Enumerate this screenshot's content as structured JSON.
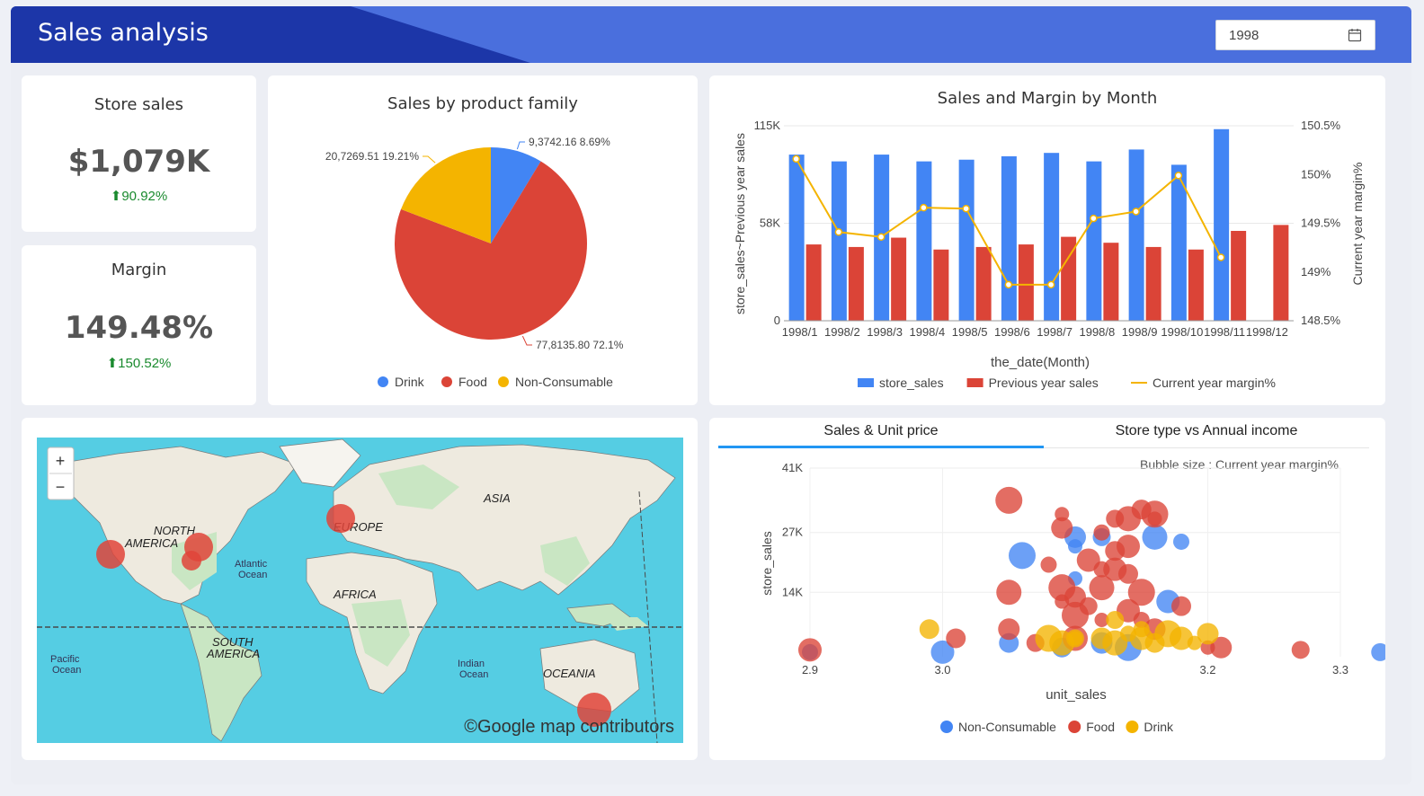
{
  "header": {
    "title": "Sales analysis",
    "year": "1998"
  },
  "kpis": {
    "store_sales": {
      "title": "Store sales",
      "value": "$1,079K",
      "delta": "90.92%"
    },
    "margin": {
      "title": "Margin",
      "value": "149.48%",
      "delta": "150.52%"
    }
  },
  "pie": {
    "title": "Sales by product family",
    "chart_data": {
      "type": "pie",
      "categories": [
        "Drink",
        "Food",
        "Non-Consumable"
      ],
      "values": [
        93742.16,
        778135.8,
        207269.51
      ],
      "percents": [
        8.69,
        72.1,
        19.21
      ],
      "labels": [
        "9,3742.16 8.69%",
        "77,8135.80 72.1%",
        "20,7269.51 19.21%"
      ],
      "colors": [
        "#4285f4",
        "#db4437",
        "#f4b400"
      ],
      "legend": "bottom"
    }
  },
  "month_chart": {
    "title": "Sales and Margin by Month",
    "chart_data": {
      "type": "bar",
      "categories": [
        "1998/1",
        "1998/2",
        "1998/3",
        "1998/4",
        "1998/5",
        "1998/6",
        "1998/7",
        "1998/8",
        "1998/9",
        "1998/10",
        "1998/11",
        "1998/12"
      ],
      "series": [
        {
          "name": "store_sales",
          "type": "bar",
          "color": "#4285f4",
          "values": [
            98000,
            94000,
            98000,
            94000,
            95000,
            97000,
            99000,
            94000,
            101000,
            92000,
            113000,
            null
          ]
        },
        {
          "name": "Previous year sales",
          "type": "bar",
          "color": "#db4437",
          "values": [
            45000,
            43500,
            49000,
            42000,
            43500,
            45000,
            49500,
            46000,
            43500,
            42000,
            53000,
            56500
          ]
        },
        {
          "name": "Current year margin%",
          "type": "line",
          "axis": "right",
          "color": "#f4b400",
          "values": [
            150.16,
            149.41,
            149.36,
            149.66,
            149.65,
            148.87,
            148.87,
            149.55,
            149.62,
            149.99,
            149.15,
            null
          ]
        }
      ],
      "xlabel": "the_date(Month)",
      "ylabel": "store_sales~Previous year sales",
      "y2label": "Current year margin%",
      "yticks": [
        "0",
        "58K",
        "115K"
      ],
      "ylim": [
        0,
        115000
      ],
      "y2ticks": [
        "148.5%",
        "149%",
        "149.5%",
        "150%",
        "150.5%"
      ],
      "y2lim": [
        148.5,
        150.5
      ],
      "legend": "bottom"
    }
  },
  "map": {
    "zoom_in": "+",
    "zoom_out": "−",
    "attribution": "©Google map contributors",
    "labels": {
      "north_america": "NORTH AMERICA",
      "south_america": "SOUTH AMERICA",
      "europe": "EUROPE",
      "asia": "ASIA",
      "africa": "AFRICA",
      "oceania": "OCEANIA",
      "atlantic": "Atlantic Ocean",
      "pacific": "Pacific Ocean",
      "indian": "Indian Ocean"
    }
  },
  "tabs": [
    "Sales & Unit price",
    "Store type vs Annual income"
  ],
  "scatter": {
    "note": "Bubble size : Current year margin%",
    "chart_data": {
      "type": "scatter",
      "xlabel": "unit_sales",
      "ylabel": "store_sales",
      "xticks": [
        "2.9",
        "3.0",
        "3.2",
        "3.3"
      ],
      "yticks": [
        "14K",
        "27K",
        "41K"
      ],
      "xlim": [
        2.9,
        3.3
      ],
      "ylim": [
        0,
        41000
      ],
      "legend": "bottom",
      "series": [
        {
          "name": "Non-Consumable",
          "color": "#4285f4",
          "points": [
            [
              2.9,
              1000
            ],
            [
              3.0,
              1000
            ],
            [
              3.05,
              3000
            ],
            [
              3.06,
              22000
            ],
            [
              3.1,
              24000
            ],
            [
              3.1,
              26000
            ],
            [
              3.12,
              26000
            ],
            [
              3.16,
              26000
            ],
            [
              3.18,
              25000
            ],
            [
              3.17,
              12000
            ],
            [
              3.09,
              2000
            ],
            [
              3.14,
              2000
            ],
            [
              3.1,
              17000
            ],
            [
              3.12,
              3000
            ],
            [
              3.33,
              1000
            ]
          ]
        },
        {
          "name": "Food",
          "color": "#db4437",
          "points": [
            [
              2.9,
              1500
            ],
            [
              3.01,
              4000
            ],
            [
              3.05,
              34000
            ],
            [
              3.09,
              31000
            ],
            [
              3.09,
              28000
            ],
            [
              3.13,
              30000
            ],
            [
              3.14,
              30000
            ],
            [
              3.12,
              27000
            ],
            [
              3.14,
              24000
            ],
            [
              3.15,
              32000
            ],
            [
              3.16,
              31000
            ],
            [
              3.16,
              30000
            ],
            [
              3.1,
              13000
            ],
            [
              3.11,
              11000
            ],
            [
              3.12,
              15000
            ],
            [
              3.12,
              19000
            ],
            [
              3.13,
              19000
            ],
            [
              3.14,
              18000
            ],
            [
              3.15,
              14000
            ],
            [
              3.12,
              8000
            ],
            [
              3.05,
              6000
            ],
            [
              3.07,
              3000
            ],
            [
              3.1,
              4000
            ],
            [
              3.15,
              8000
            ],
            [
              3.14,
              10000
            ],
            [
              3.18,
              11000
            ],
            [
              3.1,
              9000
            ],
            [
              3.2,
              2000
            ],
            [
              3.21,
              2000
            ],
            [
              3.27,
              1500
            ],
            [
              3.05,
              14000
            ],
            [
              3.08,
              20000
            ],
            [
              3.11,
              21000
            ],
            [
              3.13,
              23000
            ],
            [
              3.09,
              15000
            ],
            [
              3.09,
              12000
            ],
            [
              3.16,
              6000
            ]
          ]
        },
        {
          "name": "Drink",
          "color": "#f4b400",
          "points": [
            [
              2.99,
              6000
            ],
            [
              3.08,
              4000
            ],
            [
              3.1,
              4000
            ],
            [
              3.12,
              4000
            ],
            [
              3.13,
              8000
            ],
            [
              3.13,
              3000
            ],
            [
              3.15,
              6000
            ],
            [
              3.15,
              4000
            ],
            [
              3.16,
              3000
            ],
            [
              3.17,
              5000
            ],
            [
              3.19,
              3000
            ],
            [
              3.2,
              5000
            ],
            [
              3.1,
              4000
            ],
            [
              3.09,
              3000
            ],
            [
              3.14,
              5000
            ],
            [
              3.18,
              4000
            ]
          ]
        }
      ]
    }
  }
}
